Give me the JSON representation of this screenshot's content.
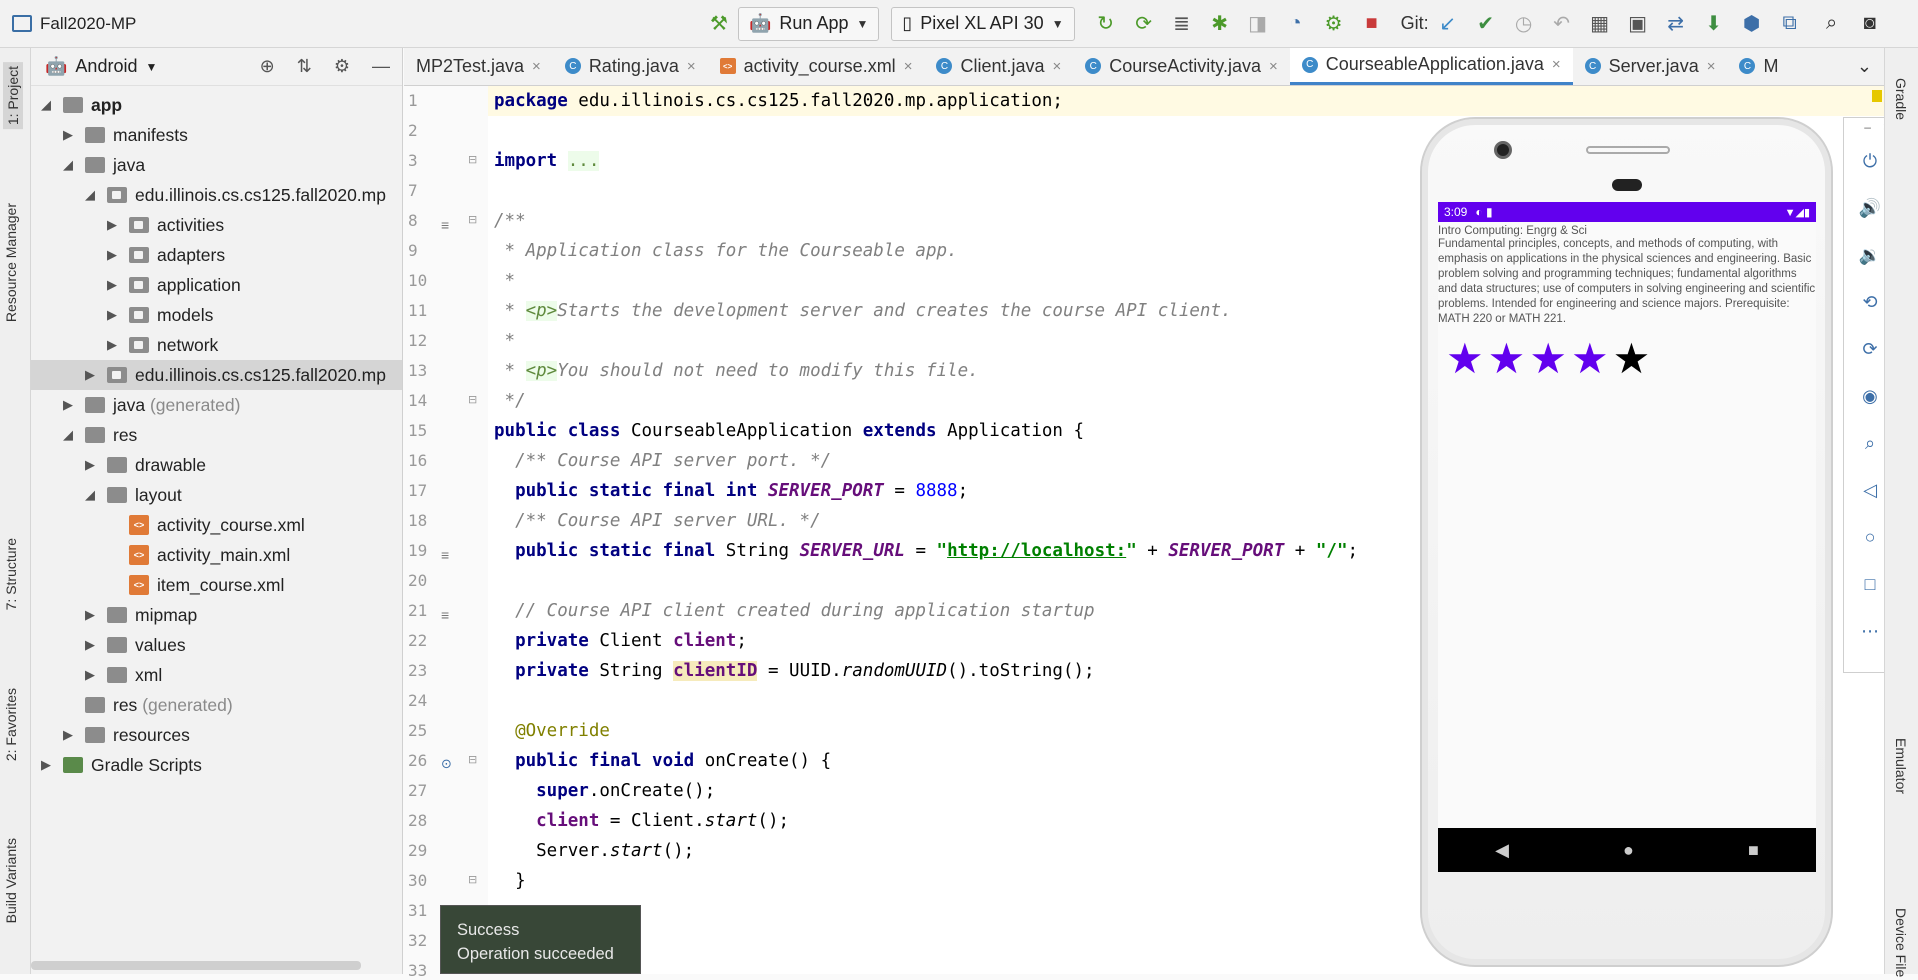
{
  "window": {
    "title": "Fall2020-MP"
  },
  "toolbar": {
    "run_config": "Run App",
    "device": "Pixel XL API 30",
    "git_label": "Git:"
  },
  "left_tool_tabs": {
    "project": "1: Project",
    "resource_manager": "Resource Manager",
    "structure": "7: Structure",
    "favorites": "2: Favorites",
    "build_variants": "Build Variants"
  },
  "right_tool_tabs": {
    "gradle": "Gradle",
    "emulator": "Emulator",
    "device_file": "Device File"
  },
  "project_panel": {
    "view": "Android"
  },
  "tree": [
    {
      "label": "app"
    },
    {
      "label": "manifests"
    },
    {
      "label": "java"
    },
    {
      "label": "edu.illinois.cs.cs125.fall2020.mp"
    },
    {
      "label": "activities"
    },
    {
      "label": "adapters"
    },
    {
      "label": "application"
    },
    {
      "label": "models"
    },
    {
      "label": "network"
    },
    {
      "label": "edu.illinois.cs.cs125.fall2020.mp"
    },
    {
      "label": "java",
      "suffix": "(generated)"
    },
    {
      "label": "res"
    },
    {
      "label": "drawable"
    },
    {
      "label": "layout"
    },
    {
      "label": "activity_course.xml"
    },
    {
      "label": "activity_main.xml"
    },
    {
      "label": "item_course.xml"
    },
    {
      "label": "mipmap"
    },
    {
      "label": "values"
    },
    {
      "label": "xml"
    },
    {
      "label": "res",
      "suffix": "(generated)"
    },
    {
      "label": "resources"
    },
    {
      "label": "Gradle Scripts"
    }
  ],
  "tabs": [
    {
      "label": "MP2Test.java"
    },
    {
      "label": "Rating.java"
    },
    {
      "label": "activity_course.xml"
    },
    {
      "label": "Client.java"
    },
    {
      "label": "CourseActivity.java"
    },
    {
      "label": "CourseableApplication.java"
    },
    {
      "label": "Server.java"
    },
    {
      "label": "M"
    }
  ],
  "code": {
    "l1": {
      "kw": "package",
      "rest": " edu.illinois.cs.cs125.fall2020.mp.application;"
    },
    "l3": {
      "kw": "import",
      "rest": "..."
    },
    "l8": "/**",
    "l9": " * Application class for the Courseable app.",
    "l10": " *",
    "l11_pre": " * ",
    "l11_tag": "<p>",
    "l11_post": "Starts the development server and creates the course API client.",
    "l12": " *",
    "l13_pre": " * ",
    "l13_tag": "<p>",
    "l13_post": "You should not need to modify this file.",
    "l14": " */",
    "l15": {
      "kw1": "public class",
      "name": " CourseableApplication ",
      "kw2": "extends",
      "rest": " Application {"
    },
    "l16": "  /** Course API server port. */",
    "l17": {
      "kw": "  public static final int ",
      "field": "SERVER_PORT",
      "eq": " = ",
      "num": "8888",
      "end": ";"
    },
    "l18": "  /** Course API server URL. */",
    "l19": {
      "kw": "  public static final ",
      "type": "String ",
      "field": "SERVER_URL",
      "eq": " = ",
      "q1": "\"",
      "url": "http://localhost:",
      "q2": "\"",
      "plus": " + ",
      "field2": "SERVER_PORT",
      "plus2": " + ",
      "str": "\"/\"",
      "end": ";"
    },
    "l21": "  // Course API client created during application startup",
    "l22": {
      "kw": "  private ",
      "type": "Client ",
      "field": "client",
      "end": ";"
    },
    "l23": {
      "kw": "  private ",
      "type": "String ",
      "field": "clientID",
      "eq": " = UUID.",
      "method": "randomUUID",
      "end": "().toString();"
    },
    "l25": "  @Override",
    "l26": {
      "kw": "  public final void",
      "rest": " onCreate() {"
    },
    "l27": {
      "kw": "    super",
      "rest": ".onCreate();"
    },
    "l28": {
      "field": "    client",
      "eq": " = Client.",
      "method": "start",
      "end": "();"
    },
    "l29": {
      "pre": "    Server.",
      "method": "start",
      "end": "();"
    },
    "l30": "  }"
  },
  "line_numbers": [
    "1",
    "2",
    "3",
    "7",
    "8",
    "9",
    "10",
    "11",
    "12",
    "13",
    "14",
    "15",
    "16",
    "17",
    "18",
    "19",
    "20",
    "21",
    "22",
    "23",
    "24",
    "25",
    "26",
    "27",
    "28",
    "29",
    "30",
    "31",
    "32",
    "33"
  ],
  "emulator": {
    "time": "3:09",
    "course_title": "Intro Computing: Engrg & Sci",
    "course_description": "Fundamental principles, concepts, and methods of computing, with emphasis on applications in the physical sciences and engineering. Basic problem solving and programming techniques; fundamental algorithms and data structures; use of computers in solving engineering and scientific problems. Intended for engineering and science majors. Prerequisite: MATH 220 or MATH 221.",
    "rating": 4,
    "rating_max": 5
  },
  "toast": {
    "title": "Success",
    "message": "Operation succeeded"
  }
}
